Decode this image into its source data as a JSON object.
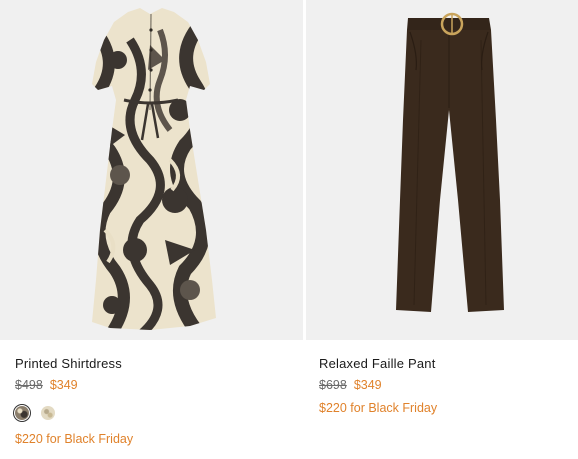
{
  "products": [
    {
      "name": "Printed Shirtdress",
      "original_price": "$498",
      "sale_price": "$349",
      "promo": "$220 for Black Friday",
      "image_bg": "#f0f0f0",
      "swatches": [
        {
          "color": "#6e6253",
          "pattern": "print-dark",
          "selected": true
        },
        {
          "color": "#e3dac3",
          "pattern": "print-light",
          "selected": false
        }
      ]
    },
    {
      "name": "Relaxed Faille Pant",
      "original_price": "$698",
      "sale_price": "$349",
      "promo": "$220 for Black Friday",
      "image_bg": "#f0f0f0"
    }
  ],
  "colors": {
    "sale": "#e0822b",
    "strikethrough": "#6b6b6b",
    "pant": "#3a2a1d",
    "dress_base": "#ece3cc",
    "dress_print": "#3b3530"
  }
}
